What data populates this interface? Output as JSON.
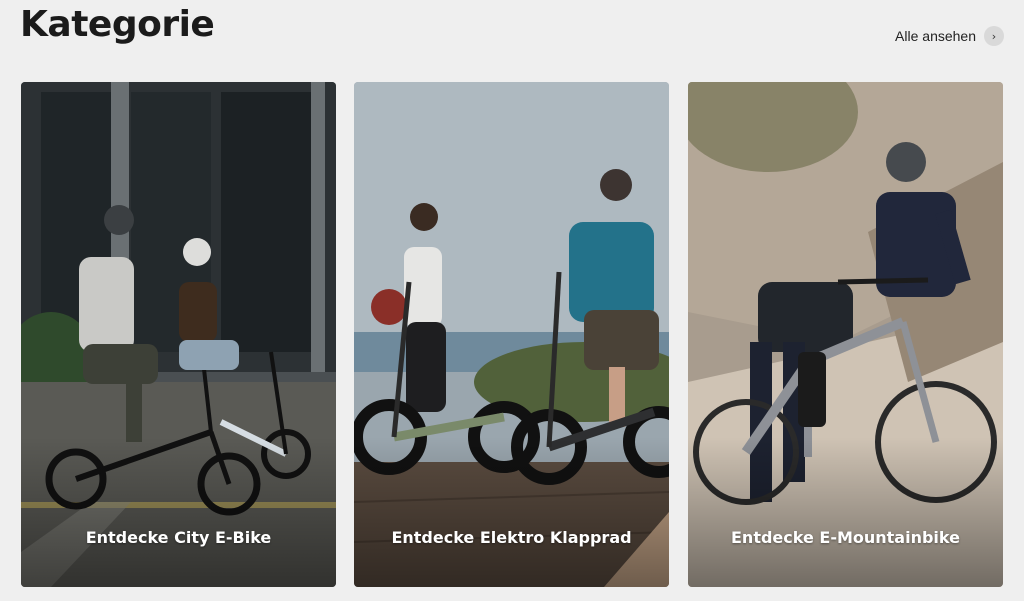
{
  "section": {
    "title": "Kategorie",
    "see_all_label": "Alle ansehen",
    "see_all_icon": "chevron-right-icon"
  },
  "cards": [
    {
      "label": "Entdecke City E-Bike",
      "scene": "two riders on folding city e-bikes in front of a glass building"
    },
    {
      "label": "Entdecke Elektro Klapprad",
      "scene": "man and woman with fat-tire folding e-bikes on a boardwalk by the sea"
    },
    {
      "label": "Entdecke E-Mountainbike",
      "scene": "man with helmet on a grey e-mountainbike in front of rocky terrain"
    }
  ]
}
